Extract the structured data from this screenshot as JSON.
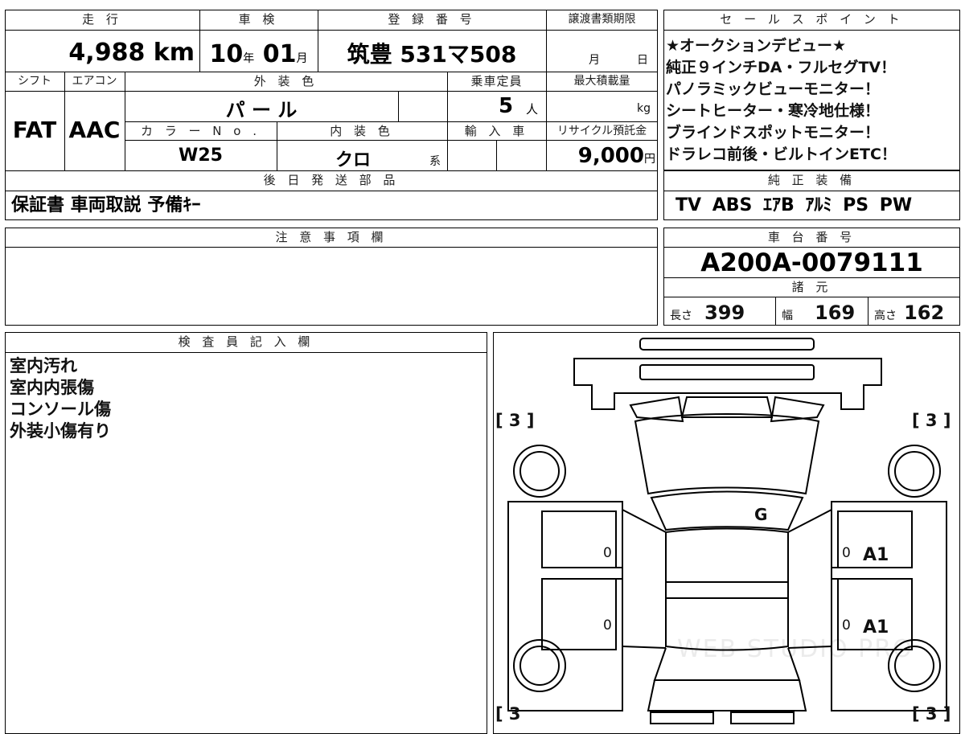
{
  "headers": {
    "mileage": "走 行",
    "inspection": "車 検",
    "registration": "登 録 番 号",
    "transfer_deadline": "譲渡書類期限",
    "sales_point": "セ ー ル ス ポ イ ン ト",
    "shift": "シフト",
    "aircon": "エアコン",
    "exterior_color": "外 装 色",
    "capacity": "乗車定員",
    "max_load": "最大積載量",
    "color_no": "カ ラ ー N o .",
    "interior_color": "内 装 色",
    "import": "輸 入 車",
    "recycle": "リサイクル預託金",
    "later_parts": "後 日 発 送 部 品",
    "genuine_equipment": "純 正 装 備",
    "notes": "注 意 事 項 欄",
    "chassis_no": "車 台 番 号",
    "specs": "諸 元",
    "inspector": "検 査 員 記 入 欄"
  },
  "values": {
    "mileage_num": "4,988",
    "mileage_unit": "km",
    "insp_year": "10",
    "insp_year_unit": "年",
    "insp_month": "01",
    "insp_month_unit": "月",
    "registration": "筑豊 531マ508",
    "transfer_month": "月",
    "transfer_day": "日",
    "shift": "FAT",
    "aircon": "AAC",
    "exterior_color": "パ ー ル",
    "capacity": "5",
    "capacity_unit": "人",
    "max_load_unit": "kg",
    "color_no": "W25",
    "interior_color": "クロ",
    "interior_suffix": "系",
    "recycle": "9,000",
    "recycle_unit": "円",
    "later_parts": "保証書 車両取説 予備ｷｰ",
    "genuine_equipment": "TV ABS ｴｱB ｱﾙﾐ PS PW",
    "chassis_no": "A200A-0079111",
    "length_label": "長さ",
    "length": "399",
    "width_label": "幅",
    "width": "169",
    "height_label": "高さ",
    "height": "162"
  },
  "sales_points": [
    "★オークションデビュー★",
    "純正９インチDA・フルセグTV！",
    "パノラミックビューモニター！",
    "シートヒーター・寒冷地仕様！",
    "ブラインドスポットモニター！",
    "ドラレコ前後・ビルトインETC！"
  ],
  "inspector_notes": [
    "室内汚れ",
    "室内内張傷",
    "コンソール傷",
    "外装小傷有り"
  ],
  "diagram": {
    "tire_tl": "[ 3 ]",
    "tire_tr": "[ 3 ]",
    "tire_bl": "[ 3",
    "tire_br": "[ 3 ]",
    "mark_windshield": "G",
    "mark_front_right_door": "A1",
    "mark_rear_right_door": "A1",
    "zero1": "0",
    "zero2": "0",
    "zero3": "0",
    "zero4": "0",
    "watermark": "WEB STUDIO PRO"
  }
}
